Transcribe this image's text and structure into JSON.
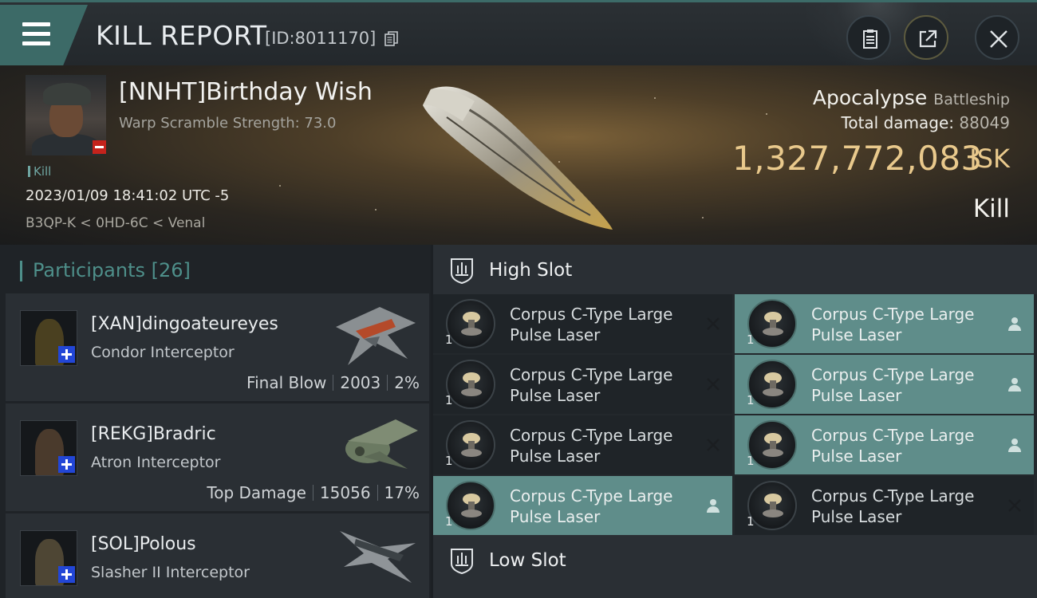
{
  "header": {
    "title": "KILL REPORT",
    "report_id": "[ID:8011170]",
    "icons": [
      "menu-icon",
      "copy-icon",
      "clipboard-icon",
      "share-icon",
      "close-icon"
    ]
  },
  "victim": {
    "name": "[NNHT]Birthday Wish",
    "warp_scramble": "Warp Scramble Strength: 73.0",
    "kill_tag": "Kill",
    "datetime": "2023/01/09 18:41:02 UTC -5",
    "location": "B3QP-K < 0HD-6C < Venal",
    "ship_name": "Apocalypse",
    "ship_class": "Battleship",
    "total_damage_label": "Total damage:",
    "total_damage_value": "88049",
    "isk_value": "1,327,772,083",
    "isk_unit": "ISK",
    "result": "Kill"
  },
  "participants": {
    "label": "Participants",
    "count": "[26]",
    "items": [
      {
        "name": "[XAN]dingoateureyes",
        "ship": "Condor Interceptor",
        "role": "Final Blow",
        "damage": "2003",
        "percent": "2%"
      },
      {
        "name": "[REKG]Bradric",
        "ship": "Atron Interceptor",
        "role": "Top Damage",
        "damage": "15056",
        "percent": "17%"
      },
      {
        "name": "[SOL]Polous",
        "ship": "Slasher II Interceptor"
      }
    ]
  },
  "slots": {
    "high_label": "High Slot",
    "low_label": "Low Slot",
    "high_modules": [
      {
        "line1": "Corpus C-Type Large",
        "line2": "Pulse Laser",
        "qty": "1",
        "status": "destroyed-x-icon"
      },
      {
        "line1": "Corpus C-Type Large",
        "line2": "Pulse Laser",
        "qty": "1",
        "status": "dropped-person-icon"
      },
      {
        "line1": "Corpus C-Type Large",
        "line2": "Pulse Laser",
        "qty": "1",
        "status": "destroyed-x-icon"
      },
      {
        "line1": "Corpus C-Type Large",
        "line2": "Pulse Laser",
        "qty": "1",
        "status": "dropped-person-icon"
      },
      {
        "line1": "Corpus C-Type Large",
        "line2": "Pulse Laser",
        "qty": "1",
        "status": "destroyed-x-icon"
      },
      {
        "line1": "Corpus C-Type Large",
        "line2": "Pulse Laser",
        "qty": "1",
        "status": "dropped-person-icon"
      },
      {
        "line1": "Corpus C-Type Large",
        "line2": "Pulse Laser",
        "qty": "1",
        "status": "dropped-person-icon"
      },
      {
        "line1": "Corpus C-Type Large",
        "line2": "Pulse Laser",
        "qty": "1",
        "status": "destroyed-x-icon"
      }
    ]
  },
  "colors": {
    "accent_teal": "#4e8f8a",
    "isk_gold": "#e9c98c",
    "dropped_row": "#5f8d8a",
    "destroyed_row": "#1f2428"
  }
}
